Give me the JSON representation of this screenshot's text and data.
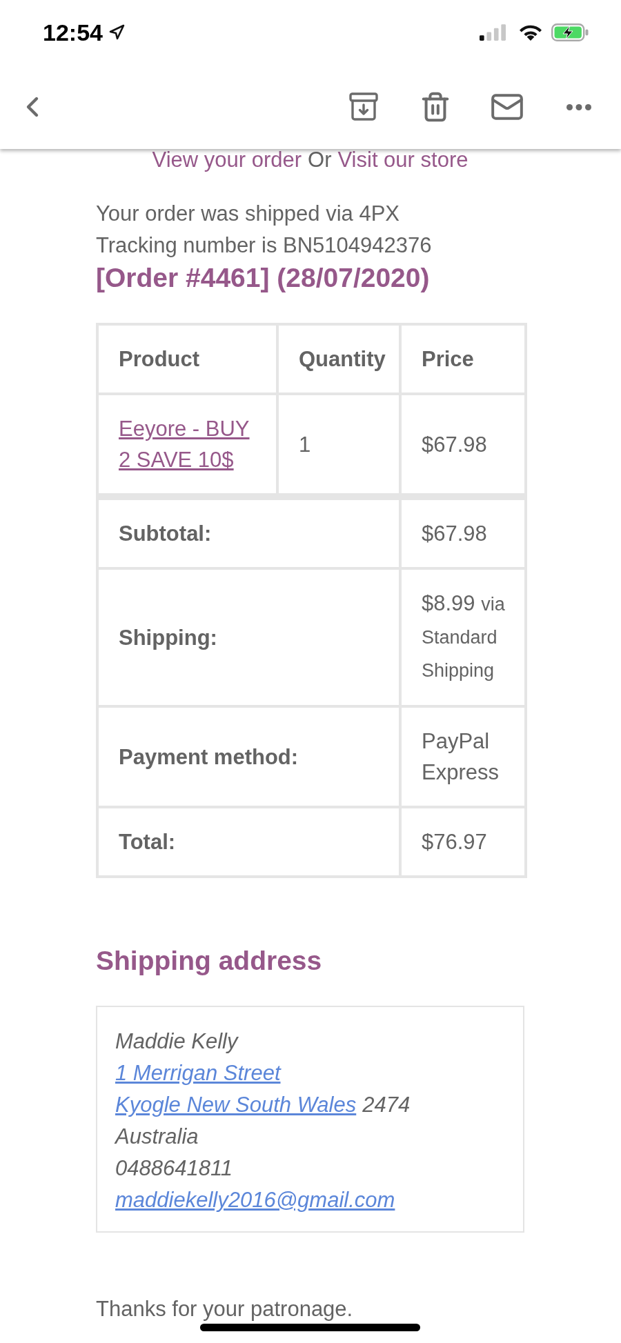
{
  "status_bar": {
    "time": "12:54"
  },
  "order_links": [
    {
      "text": "View your order",
      "kind": "link"
    },
    {
      "text": "Or",
      "kind": "text"
    },
    {
      "text": "Visit our store",
      "kind": "link"
    }
  ],
  "message_lines": [
    "Your order was shipped via 4PX",
    "Tracking number is BN5104942376"
  ],
  "order_heading": "[Order #4461] (28/07/2020)",
  "order_table": {
    "columns": [
      "Product",
      "Quantity",
      "Price"
    ],
    "rows": [
      [
        {
          "text": "Eeyore - BUY 2 SAVE 10$",
          "kind": "link"
        },
        {
          "text": "1",
          "kind": "text"
        },
        {
          "text": "$67.98",
          "kind": "text"
        }
      ]
    ],
    "totals": [
      {
        "label": "Subtotal:",
        "value": "$67.98"
      },
      {
        "label": "Shipping:",
        "value": "$8.99",
        "note": "via Standard Shipping"
      },
      {
        "label": "Payment method:",
        "value": "PayPal Express"
      },
      {
        "label": "Total:",
        "value": "$76.97"
      }
    ]
  },
  "shipping_address": {
    "heading": "Shipping address",
    "lines": [
      [
        {
          "text": "Maddie Kelly",
          "kind": "text"
        }
      ],
      [
        {
          "text": "1 Merrigan Street",
          "kind": "link"
        }
      ],
      [
        {
          "text": "Kyogle New South Wales",
          "kind": "link"
        },
        {
          "text": "2474",
          "kind": "text"
        }
      ],
      [
        {
          "text": "Australia",
          "kind": "text"
        }
      ],
      [
        {
          "text": "0488641811",
          "kind": "text"
        }
      ],
      [
        {
          "text": "maddiekelly2016@gmail.com",
          "kind": "link"
        }
      ]
    ]
  },
  "closing": "Thanks for your patronage."
}
